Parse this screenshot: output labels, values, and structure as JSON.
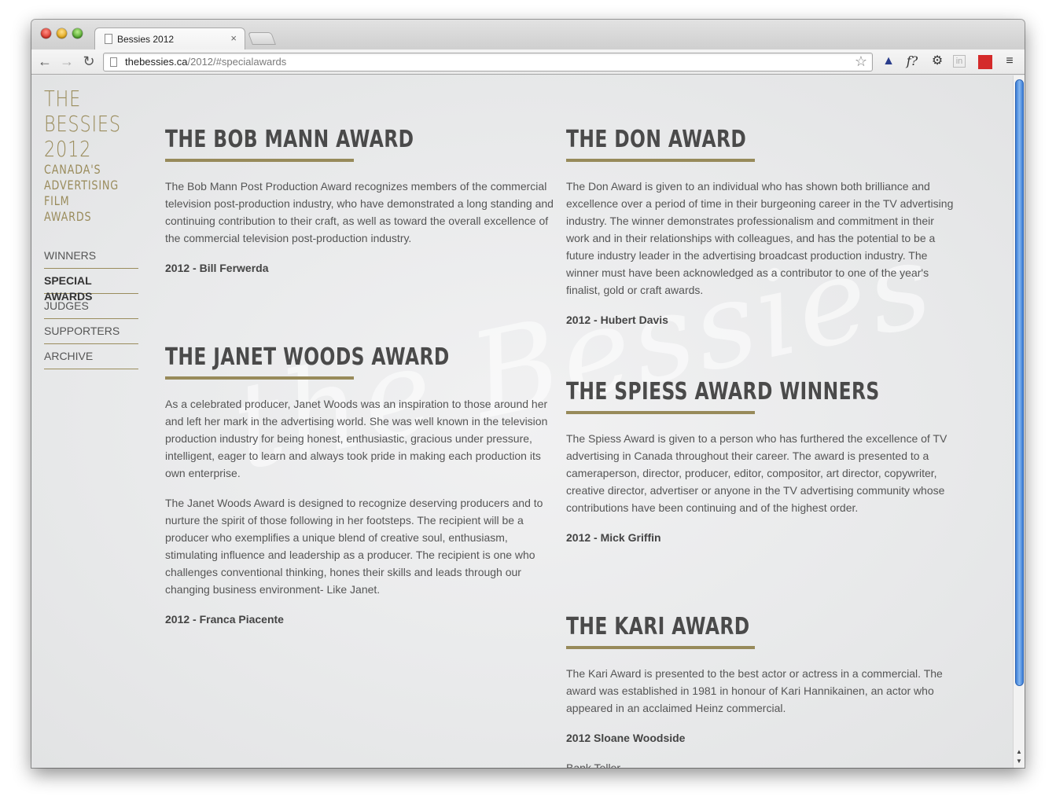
{
  "browser": {
    "tab_title": "Bessies 2012",
    "url_host": "thebessies.ca",
    "url_path": "/2012/#specialawards"
  },
  "brand": {
    "line1": "THE",
    "line2": "BESSIES",
    "line3": "2012",
    "sub1": "CANADA'S",
    "sub2": "ADVERTISING",
    "sub3": "FILM",
    "sub4": "AWARDS"
  },
  "nav": {
    "items": [
      "WINNERS",
      "SPECIAL AWARDS",
      "JUDGES",
      "SUPPORTERS",
      "ARCHIVE"
    ],
    "active": "SPECIAL AWARDS"
  },
  "watermark": "the Bessies",
  "awards": {
    "bob_mann": {
      "title": "THE BOB MANN AWARD",
      "p1": "The Bob Mann Post Production Award recognizes members of the commercial television post-production industry, who have demonstrated a long standing and continuing contribution to their craft, as well as toward the overall excellence of the commercial television post-production industry.",
      "winner": "2012 - Bill Ferwerda"
    },
    "janet_woods": {
      "title": "THE JANET WOODS AWARD",
      "p1": "As a celebrated producer, Janet Woods was an inspiration to those around her and left her mark in the advertising world. She was well known in the television production industry for being honest, enthusiastic, gracious under pressure, intelligent, eager to learn and always took pride in making each production its own enterprise.",
      "p2": "The Janet Woods Award is designed to recognize deserving producers and to nurture the spirit of those following in her footsteps. The recipient will be a producer who exemplifies a unique blend of creative soul, enthusiasm, stimulating influence and leadership as a producer. The recipient is one who challenges conventional thinking, hones their skills and leads through our changing business environment- Like Janet.",
      "winner": "2012 - Franca Piacente"
    },
    "don": {
      "title": "THE DON AWARD",
      "p1": "The Don Award is given to an individual who has shown both brilliance and excellence over a period of time in their burgeoning career in the TV advertising industry. The winner demonstrates professionalism and commitment in their work and in their relationships with colleagues, and has the potential to be a future industry leader in the advertising broadcast production industry. The winner must have been acknowledged as a contributor to one of the year's finalist, gold or craft awards.",
      "winner": "2012 - Hubert Davis"
    },
    "spiess": {
      "title": "THE SPIESS AWARD WINNERS",
      "p1": "The Spiess Award is given to a person who has furthered the excellence of TV advertising in Canada throughout their career. The award is presented to a cameraperson, director, producer, editor, compositor, art director, copywriter, creative director, advertiser or anyone in the TV advertising community whose contributions have been continuing and of the highest order.",
      "winner": "2012 - Mick Griffin"
    },
    "kari": {
      "title": "THE KARI AWARD",
      "p1": "The Kari Award is presented to the best actor or actress in a commercial. The award was established in 1981 in honour of Kari Hannikainen, an actor who appeared in an acclaimed Heinz commercial.",
      "winner": "2012 Sloane Woodside",
      "extra": "Bank Teller"
    }
  }
}
